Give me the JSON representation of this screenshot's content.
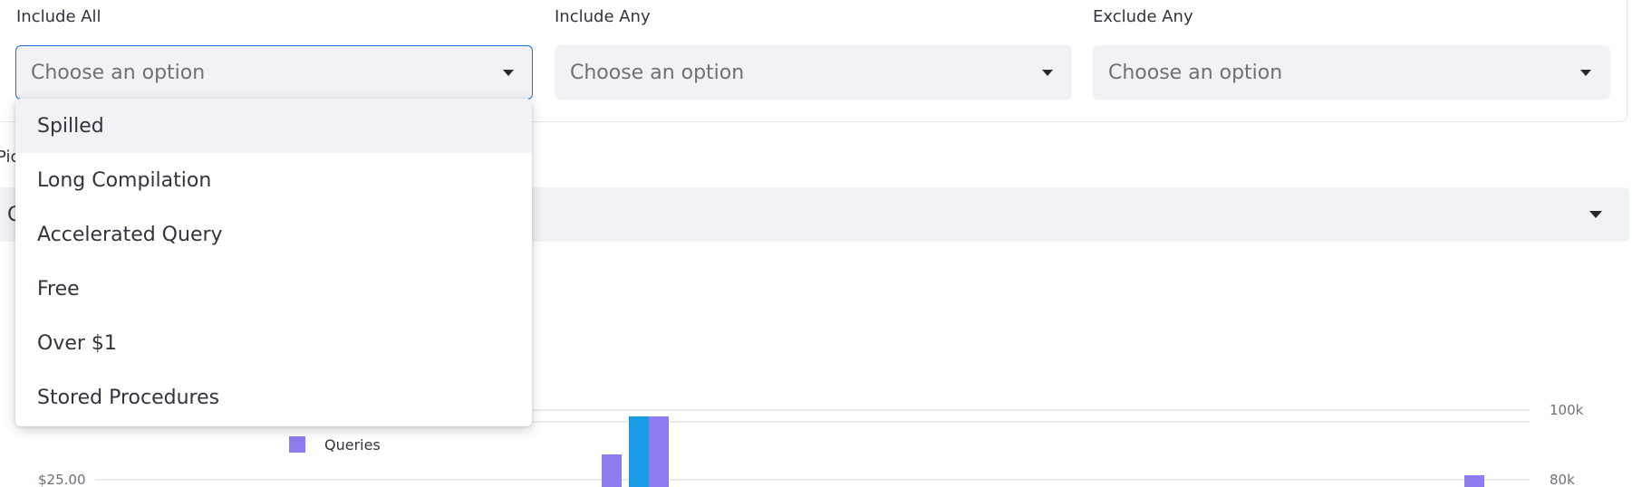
{
  "filters": {
    "include_all": {
      "label": "Include All",
      "placeholder": "Choose an option"
    },
    "include_any": {
      "label": "Include Any",
      "placeholder": "Choose an option"
    },
    "exclude_any": {
      "label": "Exclude Any",
      "placeholder": "Choose an option"
    }
  },
  "dropdown": {
    "options": [
      "Spilled",
      "Long Compilation",
      "Accelerated Query",
      "Free",
      "Over $1",
      "Stored Procedures"
    ],
    "highlighted_index": 0
  },
  "background": {
    "pick_label": "Pic",
    "picker_value": "C"
  },
  "chart_data": {
    "type": "bar",
    "legend": [
      {
        "name": "Queries",
        "color": "#8e7cf0"
      }
    ],
    "y_left_ticks": [
      "$25.00"
    ],
    "y_right_ticks": [
      "100k",
      "80k"
    ],
    "colors": {
      "cost": "#1a9be6",
      "queries": "#8e7cf0"
    }
  }
}
